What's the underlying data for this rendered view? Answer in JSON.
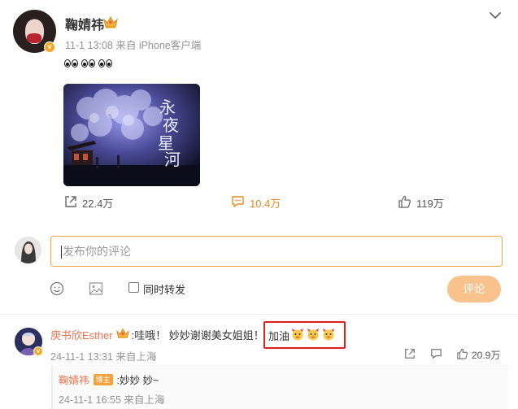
{
  "post": {
    "author": "鞠婧祎",
    "time": "11-1 13:08",
    "source": "来自 iPhone客户端",
    "stats": {
      "reposts": "22.4万",
      "comments": "10.4万",
      "likes": "119万"
    }
  },
  "composer": {
    "placeholder": "发布你的评论",
    "repost_label": "同时转发",
    "submit_label": "评论"
  },
  "comment": {
    "user": "庾书欣Esther",
    "text": ":哇哦！ 妙妙谢谢美女姐姐！",
    "highlight_text": "加油",
    "time": "24-11-1 13:31",
    "location": "来自上海",
    "likes": "20.9万"
  },
  "reply": {
    "user": "鞠婧祎",
    "badge": "博主",
    "text": ":妙妙 妙~",
    "time": "24-11-1 16:55",
    "location": "来自上海"
  },
  "icons": {
    "crown": "crown-icon",
    "chevron": "chevron-down-icon",
    "repost": "repost-icon",
    "comment": "comment-icon",
    "like": "thumbs-up-icon",
    "emoji": "emoji-icon",
    "image": "image-icon",
    "verified": "verified-v-icon"
  },
  "colors": {
    "accent": "#f2a640",
    "username_link": "#eb7350",
    "submit_disabled": "#f8c28d",
    "highlight_box": "#d9201f",
    "meta_gray": "#939393"
  }
}
